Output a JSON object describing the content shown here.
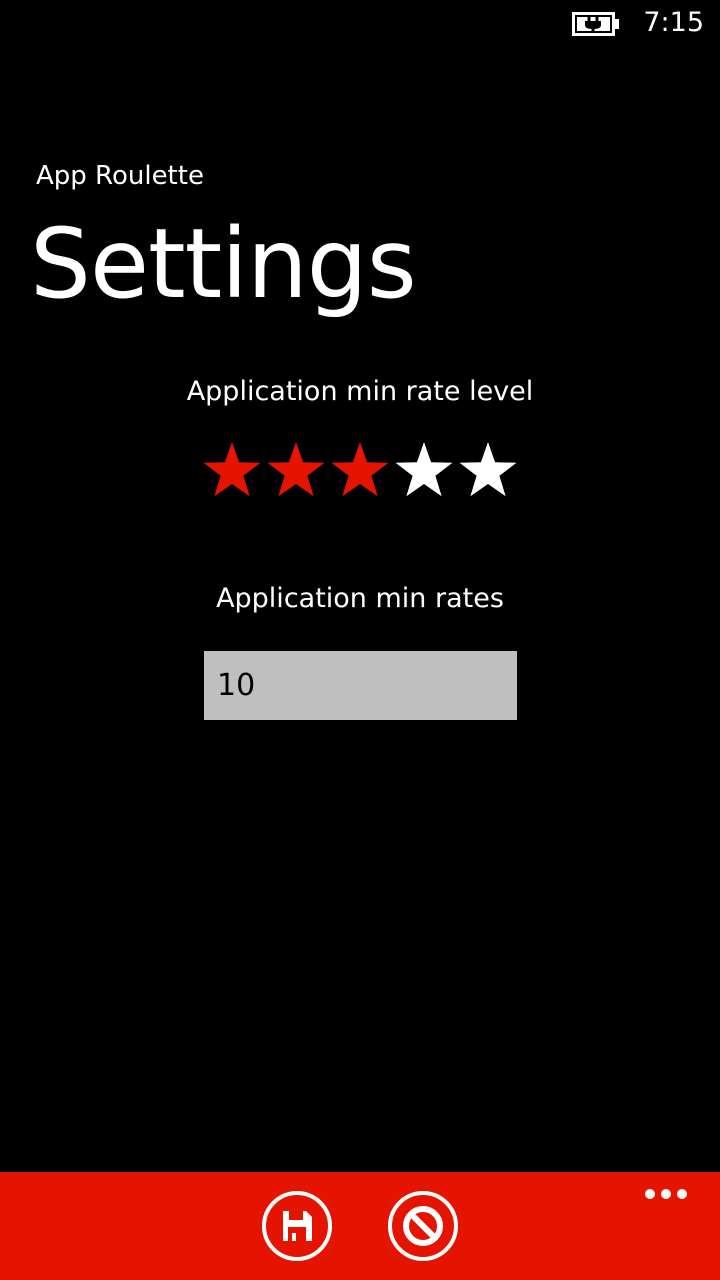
{
  "status_bar": {
    "time": "7:15",
    "battery_icon": "battery-charging-icon"
  },
  "header": {
    "app_name": "App Roulette",
    "page_title": "Settings"
  },
  "rate_level": {
    "label": "Application min rate level",
    "value": 3,
    "max": 5,
    "filled_color": "#e51400",
    "empty_color": "#ffffff"
  },
  "min_rates": {
    "label": "Application min rates",
    "value": "10"
  },
  "app_bar": {
    "background": "#e51400",
    "buttons": [
      {
        "name": "save",
        "icon": "floppy-disk-icon"
      },
      {
        "name": "cancel",
        "icon": "prohibited-icon"
      }
    ],
    "more_icon": "ellipsis-icon"
  }
}
